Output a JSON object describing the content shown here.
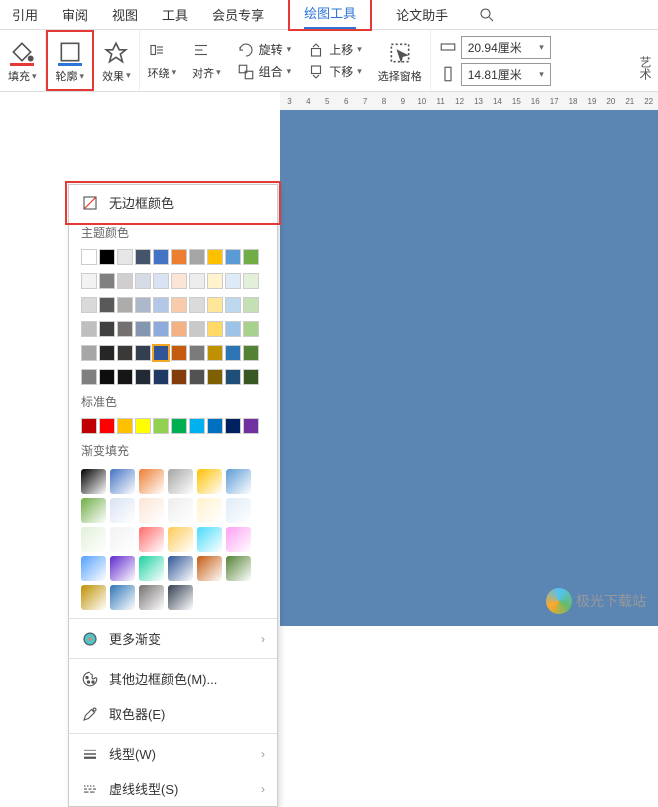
{
  "tabs": {
    "t0": "引用",
    "t1": "审阅",
    "t2": "视图",
    "t3": "工具",
    "t4": "会员专享",
    "t5": "绘图工具",
    "t6": "论文助手"
  },
  "toolbar": {
    "fill": "填充",
    "outline": "轮廓",
    "effect": "效果",
    "wrap": "环绕",
    "align": "对齐",
    "rotate": "旋转",
    "group": "组合",
    "moveUp": "上移",
    "moveDown": "下移",
    "selectPane": "选择窗格",
    "width": "20.94厘米",
    "height": "14.81厘米",
    "artText": "艺术"
  },
  "ruler": [
    "3",
    "4",
    "5",
    "6",
    "7",
    "8",
    "9",
    "10",
    "11",
    "12",
    "13",
    "14",
    "15",
    "16",
    "17",
    "18",
    "19",
    "20",
    "21",
    "22"
  ],
  "dropdown": {
    "noBorder": "无边框颜色",
    "themeColors": "主题颜色",
    "standardColors": "标准色",
    "gradientFill": "渐变填充",
    "moreGradient": "更多渐变",
    "otherBorderColor": "其他边框颜色(M)...",
    "eyedropper": "取色器(E)",
    "lineStyle": "线型(W)",
    "dashStyle": "虚线线型(S)"
  },
  "watermark": "极光下载站",
  "colors": {
    "themeRow1": [
      "#ffffff",
      "#000000",
      "#e7e6e6",
      "#44546a",
      "#4472c4",
      "#ed7d31",
      "#a5a5a5",
      "#ffc000",
      "#5b9bd5",
      "#70ad47"
    ],
    "themeRows": [
      [
        "#f2f2f2",
        "#808080",
        "#d0cece",
        "#d6dce5",
        "#d9e2f3",
        "#fbe5d6",
        "#ededed",
        "#fff2cc",
        "#deebf7",
        "#e2f0d9"
      ],
      [
        "#d9d9d9",
        "#595959",
        "#aeabab",
        "#adb9ca",
        "#b4c7e7",
        "#f7cbac",
        "#dbdbdb",
        "#ffe699",
        "#bdd7ee",
        "#c5e0b4"
      ],
      [
        "#bfbfbf",
        "#404040",
        "#757070",
        "#8497b0",
        "#8faadc",
        "#f4b183",
        "#c9c9c9",
        "#ffd966",
        "#9dc3e6",
        "#a9d18e"
      ],
      [
        "#a6a6a6",
        "#262626",
        "#3b3838",
        "#333f50",
        "#2f5597",
        "#c55a11",
        "#7b7b7b",
        "#bf9000",
        "#2e75b6",
        "#548235"
      ],
      [
        "#7f7f7f",
        "#0d0d0d",
        "#171616",
        "#222a35",
        "#1f3864",
        "#843c0c",
        "#525252",
        "#7f6000",
        "#1f4e79",
        "#385723"
      ]
    ],
    "standard": [
      "#c00000",
      "#ff0000",
      "#ffc000",
      "#ffff00",
      "#92d050",
      "#00b050",
      "#00b0f0",
      "#0070c0",
      "#002060",
      "#7030a0"
    ],
    "gradients": [
      [
        "#000000",
        "#4472c4",
        "#ed7d31",
        "#a5a5a5",
        "#ffc000",
        "#5b9bd5",
        "#70ad47"
      ],
      [
        "#d9e2f3",
        "#fbe5d6",
        "#ededed",
        "#fff2cc",
        "#deebf7",
        "#e2f0d9",
        "#f2f2f2"
      ],
      [
        "#ff6b6b",
        "#feca57",
        "#48dbfb",
        "#ff9ff3",
        "#54a0ff",
        "#5f27cd",
        "#1dd1a1"
      ],
      [
        "#2f5597",
        "#c55a11",
        "#548235",
        "#bf9000",
        "#2e75b6",
        "#757070",
        "#333f50"
      ]
    ]
  }
}
